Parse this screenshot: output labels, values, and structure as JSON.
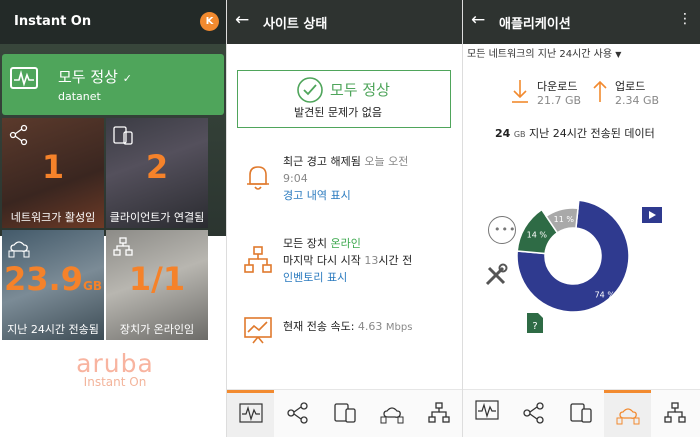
{
  "panel1": {
    "app_title": "Instant On",
    "avatar_initial": "K",
    "status_title": "모두 정상",
    "status_sub": "datanet",
    "tiles": [
      {
        "value": "1",
        "unit": "",
        "label": "네트워크가 활성임"
      },
      {
        "value": "2",
        "unit": "",
        "label": "클라이언트가 연결됨"
      },
      {
        "value": "23.9",
        "unit": "GB",
        "label": "지난 24시간 전송됨"
      },
      {
        "value": "1/1",
        "unit": "",
        "label": "장치가 온라인임"
      }
    ],
    "brand_name": "aruba",
    "brand_sub": "Instant On"
  },
  "panel2": {
    "title": "사이트 상태",
    "ok_title": "모두 정상",
    "ok_sub": "발견된 문제가 없음",
    "alert_line1": "최근 경고 해제됨",
    "alert_when": "오늘 오전",
    "alert_time": "9:04",
    "alert_link": "경고 내역 표시",
    "devices_line1": "모든 장치",
    "devices_state": "온라인",
    "restart_line": "마지막 다시 시작",
    "restart_num": "13",
    "restart_suffix": "시간 전",
    "inventory_link": "인벤토리 표시",
    "speed_label": "현재 전송 속도:",
    "speed_value": "4.63",
    "speed_unit": "Mbps"
  },
  "panel3": {
    "title": "애플리케이션",
    "scope": "모든 네트워크의 지난 24시간 사용",
    "download_label": "다운로드",
    "download_value": "21.7 GB",
    "upload_label": "업로드",
    "upload_value": "2.34 GB",
    "total_value": "24",
    "total_unit": "GB",
    "total_label": "지난 24시간 전송된 데이터",
    "donut": [
      {
        "label": "74 %",
        "value": 74,
        "color": "#2f3a8f"
      },
      {
        "label": "14 %",
        "value": 14,
        "color": "#2e6b45"
      },
      {
        "label": "11 %",
        "value": 11,
        "color": "#a9a9a9"
      }
    ]
  },
  "colors": {
    "accent": "#f28a2f",
    "ok": "#4fa55b",
    "link": "#2b7bbf"
  },
  "icons": [
    "avatar",
    "status-wave-icon",
    "network-icon",
    "devices-icon",
    "clients-icon",
    "topology-icon",
    "back-arrow-icon",
    "check-circle-icon",
    "bell-icon",
    "speed-chart-icon",
    "download-icon",
    "upload-icon",
    "more-icon",
    "tools-icon",
    "video-icon",
    "file-icon"
  ]
}
